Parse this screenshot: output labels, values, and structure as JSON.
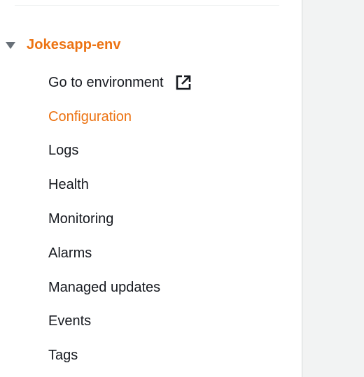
{
  "environment": {
    "name": "Jokesapp-env",
    "caret_icon": "caret-down-icon"
  },
  "nav": {
    "items": [
      {
        "label": "Go to environment",
        "icon": "external-link-icon",
        "active": false
      },
      {
        "label": "Configuration",
        "active": true
      },
      {
        "label": "Logs",
        "active": false
      },
      {
        "label": "Health",
        "active": false
      },
      {
        "label": "Monitoring",
        "active": false
      },
      {
        "label": "Alarms",
        "active": false
      },
      {
        "label": "Managed updates",
        "active": false
      },
      {
        "label": "Events",
        "active": false
      },
      {
        "label": "Tags",
        "active": false
      }
    ]
  },
  "colors": {
    "accent": "#ec7211",
    "text": "#16191f",
    "caret": "#687078",
    "content_bg": "#f2f3f3"
  }
}
